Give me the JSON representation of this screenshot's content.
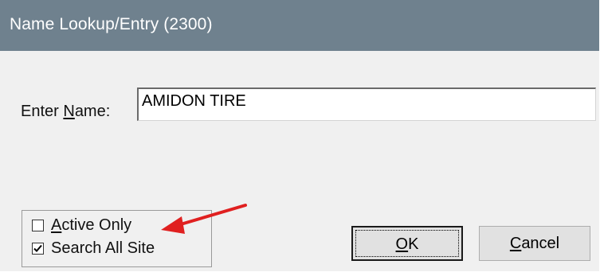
{
  "window": {
    "title": "Name Lookup/Entry (2300)"
  },
  "name_field": {
    "label_before": "Enter ",
    "label_accel": "N",
    "label_after": "ame:",
    "value": "AMIDON TIRE"
  },
  "options": {
    "active_only": {
      "label_accel": "A",
      "label_rest": "ctive Only",
      "checked": false
    },
    "search_all_site": {
      "label": "Search All Site",
      "checked": true
    }
  },
  "buttons": {
    "ok": {
      "label_accel": "O",
      "label_rest": "K"
    },
    "cancel": {
      "label_accel": "C",
      "label_rest": "ancel"
    }
  },
  "annotation": {
    "arrow_color": "#e02020"
  },
  "colors": {
    "titlebar": "#6f818e",
    "dialog_bg": "#f0f0f0"
  }
}
